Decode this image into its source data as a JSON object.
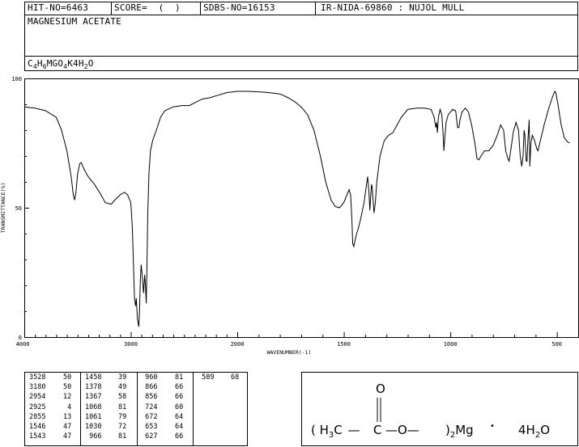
{
  "header": {
    "hit_no": "HIT-NO=6463",
    "score": "SCORE=  (  )",
    "sdbs_no": "SDBS-NO=16153",
    "ir_nida": "IR-NIDA-69860 : NUJOL MULL",
    "compound_name": "MAGNESIUM ACETATE",
    "formula": "C4H6MgO4K4H2O"
  },
  "chart_data": {
    "type": "line",
    "xlabel": "WAVENUMBER(-1)",
    "ylabel": "TRANSMITTANCE(%)",
    "xlim": [
      4000,
      400
    ],
    "ylim": [
      0,
      100
    ],
    "x_ticks": [
      4000,
      3000,
      2000,
      1500,
      1000,
      500
    ],
    "y_ticks": [
      0,
      50,
      100
    ],
    "series": [
      {
        "color": "#000000",
        "points": [
          [
            4000,
            89
          ],
          [
            3900,
            88.5
          ],
          [
            3800,
            87.5
          ],
          [
            3700,
            85
          ],
          [
            3650,
            80
          ],
          [
            3600,
            72
          ],
          [
            3560,
            62
          ],
          [
            3540,
            55
          ],
          [
            3528,
            53
          ],
          [
            3515,
            56
          ],
          [
            3500,
            63
          ],
          [
            3480,
            67
          ],
          [
            3465,
            67.5
          ],
          [
            3440,
            65
          ],
          [
            3400,
            62
          ],
          [
            3340,
            59
          ],
          [
            3280,
            55
          ],
          [
            3240,
            52
          ],
          [
            3200,
            51.5
          ],
          [
            3180,
            51.5
          ],
          [
            3150,
            53
          ],
          [
            3100,
            55
          ],
          [
            3060,
            56
          ],
          [
            3030,
            55
          ],
          [
            3000,
            52
          ],
          [
            2985,
            42
          ],
          [
            2975,
            28
          ],
          [
            2965,
            15
          ],
          [
            2954,
            12
          ],
          [
            2948,
            15
          ],
          [
            2938,
            7
          ],
          [
            2925,
            4
          ],
          [
            2917,
            11
          ],
          [
            2910,
            22
          ],
          [
            2903,
            28
          ],
          [
            2895,
            25
          ],
          [
            2880,
            17
          ],
          [
            2870,
            24
          ],
          [
            2862,
            20
          ],
          [
            2855,
            13
          ],
          [
            2848,
            28
          ],
          [
            2840,
            48
          ],
          [
            2830,
            63
          ],
          [
            2815,
            72
          ],
          [
            2795,
            76
          ],
          [
            2760,
            80
          ],
          [
            2720,
            85
          ],
          [
            2680,
            87.5
          ],
          [
            2600,
            89
          ],
          [
            2520,
            89.5
          ],
          [
            2450,
            89.5
          ],
          [
            2380,
            91
          ],
          [
            2330,
            92
          ],
          [
            2260,
            92.5
          ],
          [
            2180,
            93.5
          ],
          [
            2100,
            94.5
          ],
          [
            2000,
            95
          ],
          [
            1950,
            95
          ],
          [
            1900,
            94.8
          ],
          [
            1850,
            94.5
          ],
          [
            1800,
            94
          ],
          [
            1760,
            92.5
          ],
          [
            1730,
            91
          ],
          [
            1700,
            89
          ],
          [
            1670,
            86
          ],
          [
            1640,
            80
          ],
          [
            1610,
            70
          ],
          [
            1585,
            60
          ],
          [
            1560,
            53
          ],
          [
            1540,
            50.5
          ],
          [
            1520,
            50
          ],
          [
            1500,
            52
          ],
          [
            1485,
            55
          ],
          [
            1475,
            57
          ],
          [
            1468,
            55
          ],
          [
            1462,
            45
          ],
          [
            1458,
            36
          ],
          [
            1453,
            35
          ],
          [
            1448,
            37
          ],
          [
            1440,
            40
          ],
          [
            1432,
            42
          ],
          [
            1420,
            46
          ],
          [
            1405,
            52
          ],
          [
            1395,
            58
          ],
          [
            1388,
            62
          ],
          [
            1382,
            56
          ],
          [
            1378,
            49
          ],
          [
            1374,
            54
          ],
          [
            1370,
            59
          ],
          [
            1367,
            58
          ],
          [
            1362,
            52
          ],
          [
            1358,
            48
          ],
          [
            1352,
            52
          ],
          [
            1345,
            60
          ],
          [
            1330,
            70
          ],
          [
            1310,
            76
          ],
          [
            1290,
            78
          ],
          [
            1270,
            79
          ],
          [
            1250,
            82
          ],
          [
            1230,
            85
          ],
          [
            1200,
            88
          ],
          [
            1160,
            88.5
          ],
          [
            1120,
            88.5
          ],
          [
            1090,
            88
          ],
          [
            1076,
            85
          ],
          [
            1068,
            81
          ],
          [
            1064,
            83
          ],
          [
            1061,
            79
          ],
          [
            1056,
            85
          ],
          [
            1048,
            88
          ],
          [
            1040,
            86
          ],
          [
            1035,
            80
          ],
          [
            1030,
            72
          ],
          [
            1027,
            76
          ],
          [
            1020,
            83
          ],
          [
            1010,
            86
          ],
          [
            990,
            88
          ],
          [
            975,
            87.5
          ],
          [
            966,
            81
          ],
          [
            960,
            81
          ],
          [
            955,
            84
          ],
          [
            945,
            87
          ],
          [
            930,
            88.5
          ],
          [
            915,
            87
          ],
          [
            900,
            82
          ],
          [
            885,
            75
          ],
          [
            875,
            69
          ],
          [
            866,
            68.5
          ],
          [
            856,
            70
          ],
          [
            840,
            72
          ],
          [
            820,
            72
          ],
          [
            800,
            74
          ],
          [
            780,
            78
          ],
          [
            764,
            82
          ],
          [
            750,
            80
          ],
          [
            740,
            72
          ],
          [
            730,
            69
          ],
          [
            724,
            68
          ],
          [
            715,
            73
          ],
          [
            705,
            79
          ],
          [
            692,
            83
          ],
          [
            680,
            80
          ],
          [
            672,
            70
          ],
          [
            665,
            66
          ],
          [
            659,
            70
          ],
          [
            654,
            80
          ],
          [
            650,
            78
          ],
          [
            644,
            68
          ],
          [
            640,
            68
          ],
          [
            636,
            76
          ],
          [
            630,
            84
          ],
          [
            627,
            66
          ],
          [
            622,
            75
          ],
          [
            615,
            78
          ],
          [
            605,
            76
          ],
          [
            595,
            73
          ],
          [
            589,
            72
          ],
          [
            580,
            75
          ],
          [
            560,
            82
          ],
          [
            540,
            88
          ],
          [
            520,
            93
          ],
          [
            510,
            95
          ],
          [
            505,
            94.5
          ],
          [
            495,
            90
          ],
          [
            480,
            82
          ],
          [
            465,
            77
          ],
          [
            450,
            75.5
          ],
          [
            440,
            75
          ]
        ]
      }
    ]
  },
  "peak_table": [
    {
      "wn": "3528",
      "t": "50"
    },
    {
      "wn": "3180",
      "t": "50"
    },
    {
      "wn": "2954",
      "t": "12"
    },
    {
      "wn": "2925",
      "t": "4"
    },
    {
      "wn": "2855",
      "t": "13"
    },
    {
      "wn": "1546",
      "t": "47"
    },
    {
      "wn": "1543",
      "t": "47"
    },
    {
      "wn": "1458",
      "t": "39"
    },
    {
      "wn": "1378",
      "t": "49"
    },
    {
      "wn": "1367",
      "t": "58"
    },
    {
      "wn": "1068",
      "t": "81"
    },
    {
      "wn": "1061",
      "t": "79"
    },
    {
      "wn": "1030",
      "t": "72"
    },
    {
      "wn": "966",
      "t": "81"
    },
    {
      "wn": "960",
      "t": "81"
    },
    {
      "wn": "866",
      "t": "66"
    },
    {
      "wn": "856",
      "t": "66"
    },
    {
      "wn": "724",
      "t": "60"
    },
    {
      "wn": "672",
      "t": "64"
    },
    {
      "wn": "653",
      "t": "64"
    },
    {
      "wn": "627",
      "t": "66"
    },
    {
      "wn": "589",
      "t": "68"
    }
  ],
  "structure": {
    "open_paren": "( H",
    "sub3": "3",
    "carbon1": "C",
    "bond1": "—",
    "carbon2": "C",
    "bond2": "—O—",
    "close_paren": ")",
    "sub2": "2",
    "mg": "Mg",
    "dot": "•",
    "water_coef": "4H",
    "water_sub": "2",
    "water_o": "O",
    "carbonyl_o": "O"
  }
}
